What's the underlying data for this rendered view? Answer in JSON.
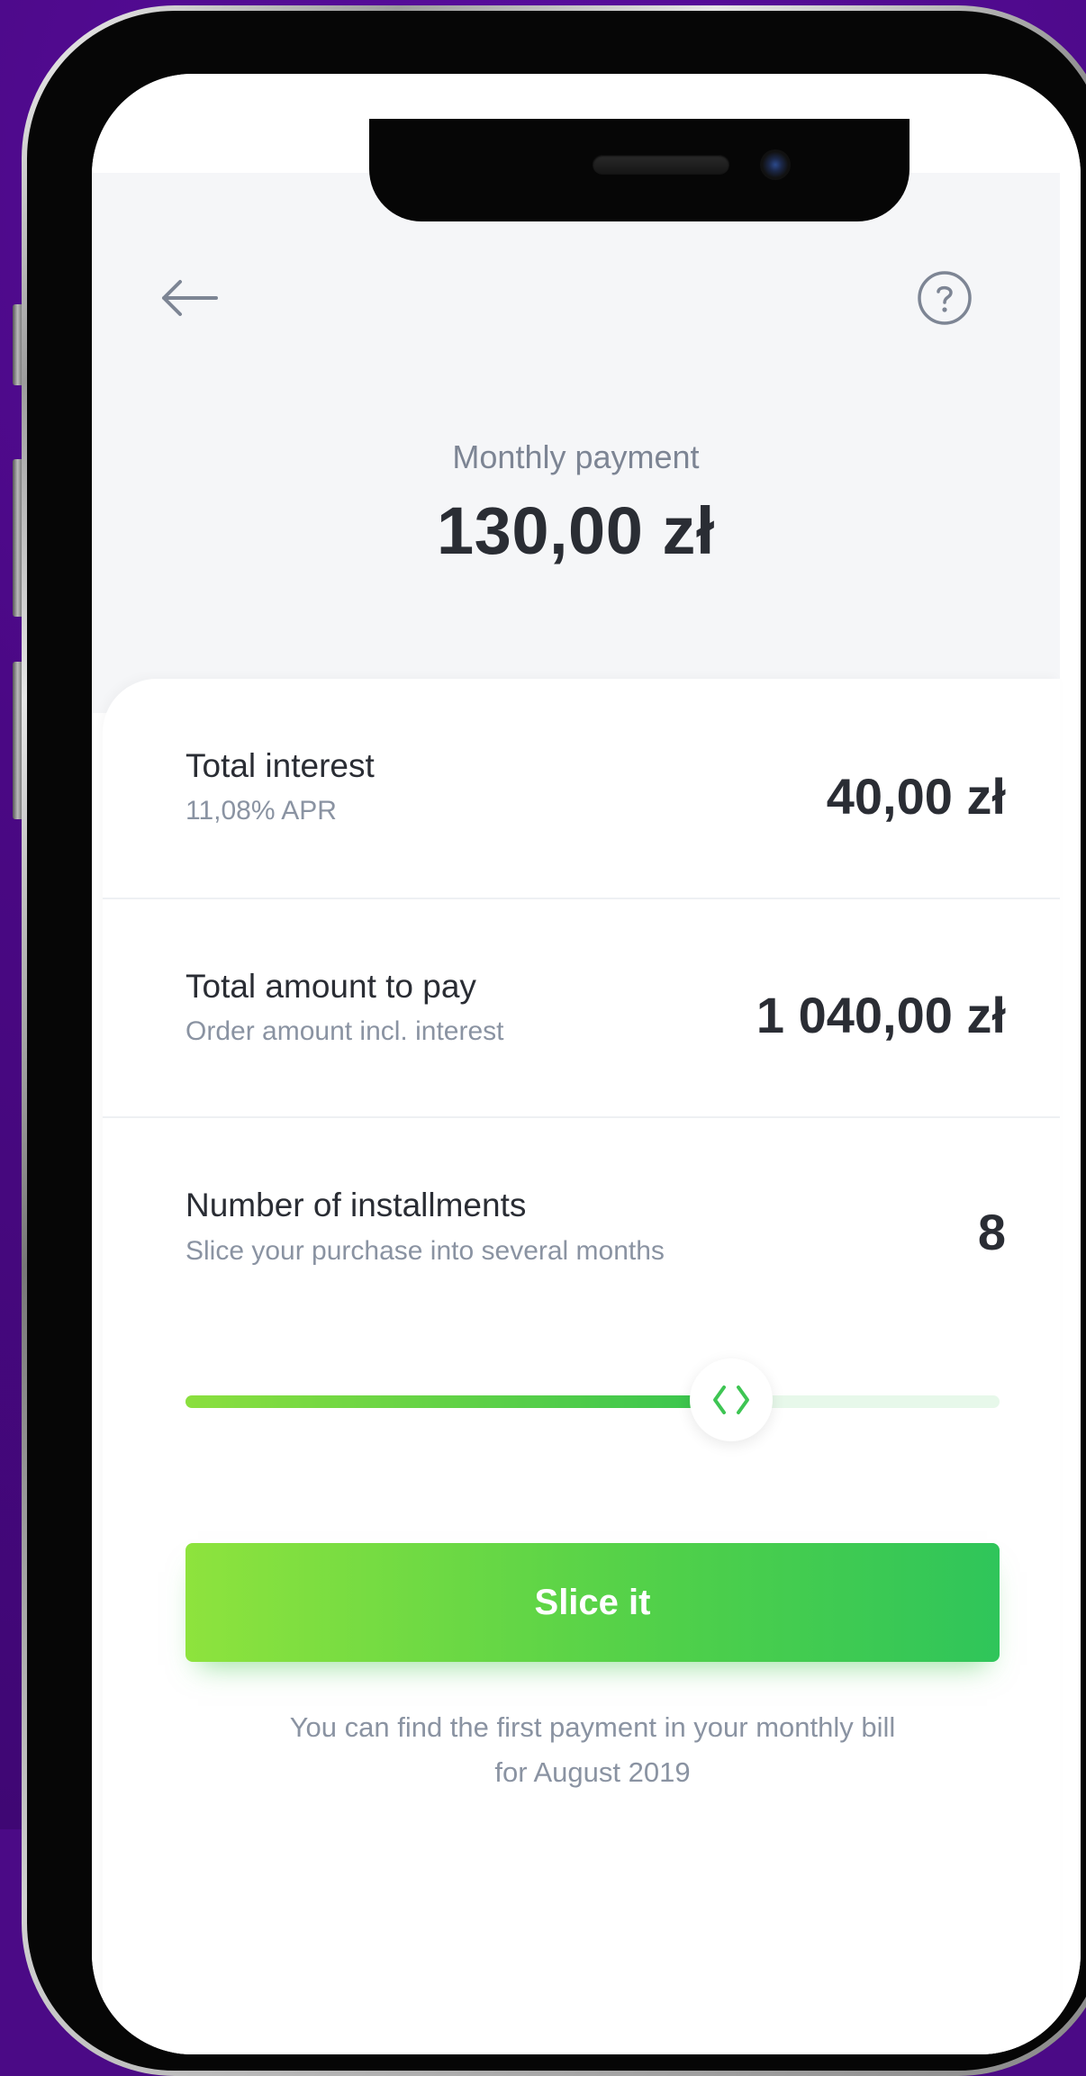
{
  "header": {
    "monthly_label": "Monthly payment",
    "monthly_value": "130,00 zł"
  },
  "rows": [
    {
      "title": "Total interest",
      "subtitle": "11,08% APR",
      "value": "40,00 zł"
    },
    {
      "title": "Total amount to pay",
      "subtitle": "Order amount incl. interest",
      "value": "1 040,00 zł"
    },
    {
      "title": "Number of installments",
      "subtitle": "Slice your purchase into several months",
      "value": "8"
    }
  ],
  "slider": {
    "fraction": 0.67
  },
  "cta": {
    "label": "Slice it"
  },
  "note": {
    "line1": "You can find the first payment in your monthly bill",
    "line2": "for August 2019"
  },
  "icons": {
    "back": "arrow-left-icon",
    "help": "question-circle-icon",
    "slider_thumb": "chevrons-left-right-icon"
  },
  "colors": {
    "background": "#4b0a86",
    "accent_start": "#8ee33d",
    "accent_end": "#2fc55a",
    "text_primary": "#2a2d34",
    "text_secondary": "#8a93a2",
    "header_bg": "#f5f6f8"
  }
}
